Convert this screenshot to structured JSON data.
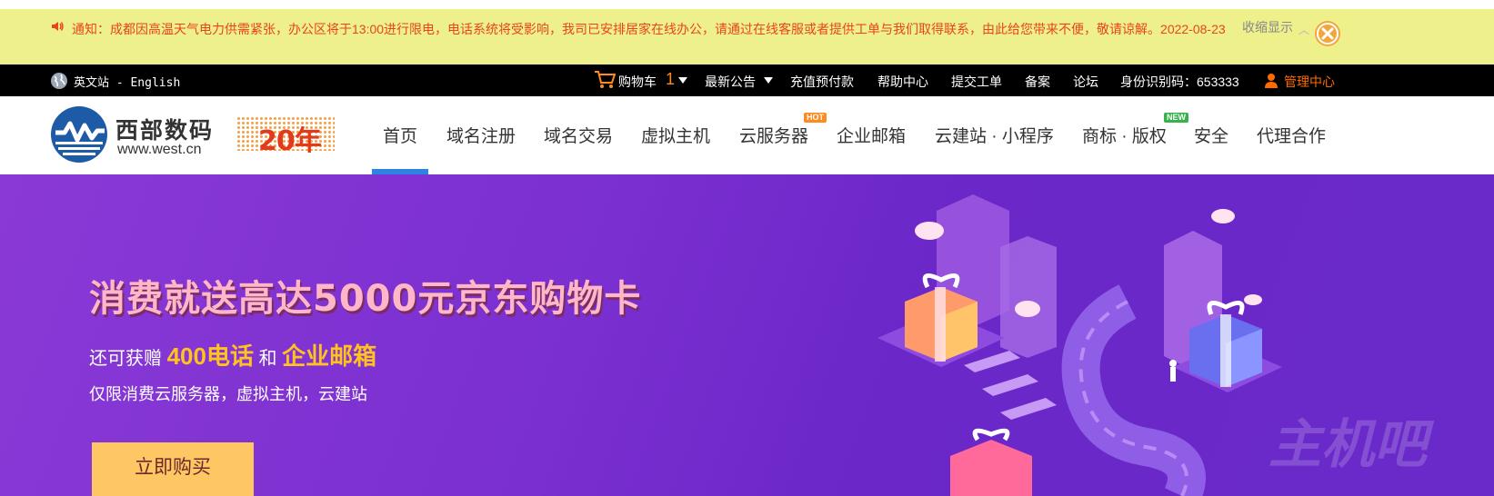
{
  "notice": {
    "text": "通知：成都因高温天气电力供需紧张，办公区将于13:00进行限电，电话系统将受影响，我司已安排居家在线办公，请通过在线客服或者提供工单与我们取得联系，由此给您带来不便，敬请谅解。2022-08-23",
    "collapse_label": "收缩显示",
    "close_icon": "close-icon"
  },
  "topbar": {
    "language": "英文站 - English",
    "cart_label": "购物车",
    "cart_count": "1",
    "announcements_label": "最新公告",
    "recharge_label": "充值预付款",
    "help_label": "帮助中心",
    "ticket_label": "提交工单",
    "filing_label": "备案",
    "forum_label": "论坛",
    "id_code": "身份识别码：653333",
    "admin_label": "管理中心"
  },
  "header": {
    "logo_cn": "西部数码",
    "logo_en": "www.west.cn",
    "anniversary": "20年",
    "nav": [
      {
        "label": "首页",
        "active": true
      },
      {
        "label": "域名注册"
      },
      {
        "label": "域名交易"
      },
      {
        "label": "虚拟主机"
      },
      {
        "label": "云服务器",
        "badge": "HOT"
      },
      {
        "label": "企业邮箱"
      },
      {
        "label": "云建站 · 小程序"
      },
      {
        "label": "商标 · 版权",
        "badge": "NEW"
      },
      {
        "label": "安全"
      },
      {
        "label": "代理合作"
      }
    ]
  },
  "banner": {
    "title": "消费就送高达5000元京东购物卡",
    "sub_prefix": "还可获赠",
    "sub_hl1": "400电话",
    "sub_and": "和",
    "sub_hl2": "企业邮箱",
    "sub2": "仅限消费云服务器，虚拟主机，云建站",
    "button": "立即购买",
    "watermark": "主机吧"
  },
  "colors": {
    "notice_bg": "#eef08c",
    "notice_text": "#e8451a",
    "topbar_bg": "#000000",
    "accent_orange": "#ff8a1f",
    "nav_active": "#2b84e3",
    "banner_purple": "#7a2fd0",
    "banner_title": "#ffb6c9",
    "highlight_yellow": "#ffc21e",
    "button_bg": "#ffc764"
  }
}
